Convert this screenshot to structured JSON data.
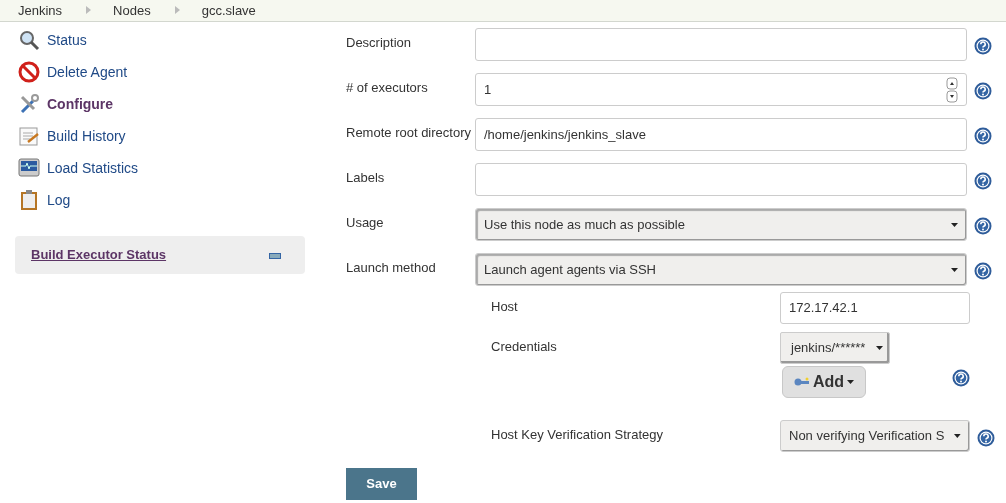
{
  "breadcrumbs": [
    "Jenkins",
    "Nodes",
    "gcc.slave"
  ],
  "sidebar": {
    "items": [
      {
        "label": "Status",
        "selected": false
      },
      {
        "label": "Delete Agent",
        "selected": false
      },
      {
        "label": "Configure",
        "selected": true
      },
      {
        "label": "Build History",
        "selected": false
      },
      {
        "label": "Load Statistics",
        "selected": false
      },
      {
        "label": "Log",
        "selected": false
      }
    ],
    "widget": {
      "title": "Build Executor Status",
      "expanded": true
    }
  },
  "form": {
    "fields": [
      {
        "label": "Description",
        "kind": "text"
      },
      {
        "label": "# of executors",
        "kind": "number",
        "value": "1"
      },
      {
        "label": "Remote root directory",
        "kind": "text",
        "value": "/home/jenkins/jenkins_slave"
      },
      {
        "label": "Labels",
        "kind": "text"
      },
      {
        "label": "Usage",
        "kind": "select",
        "value": "Use this node as much as possible"
      },
      {
        "label": "Launch method",
        "kind": "select",
        "value": "Launch agent agents via SSH"
      }
    ],
    "launch_options": [
      {
        "label": "Host",
        "kind": "text",
        "value": "172.17.42.1"
      },
      {
        "label": "Credentials",
        "kind": "credentials",
        "value": "jenkins/******",
        "add_button": "Add"
      },
      {
        "label": "Host Key Verification Strategy",
        "kind": "select",
        "value": "Non verifying Verification S"
      }
    ],
    "save_button": "Save"
  }
}
